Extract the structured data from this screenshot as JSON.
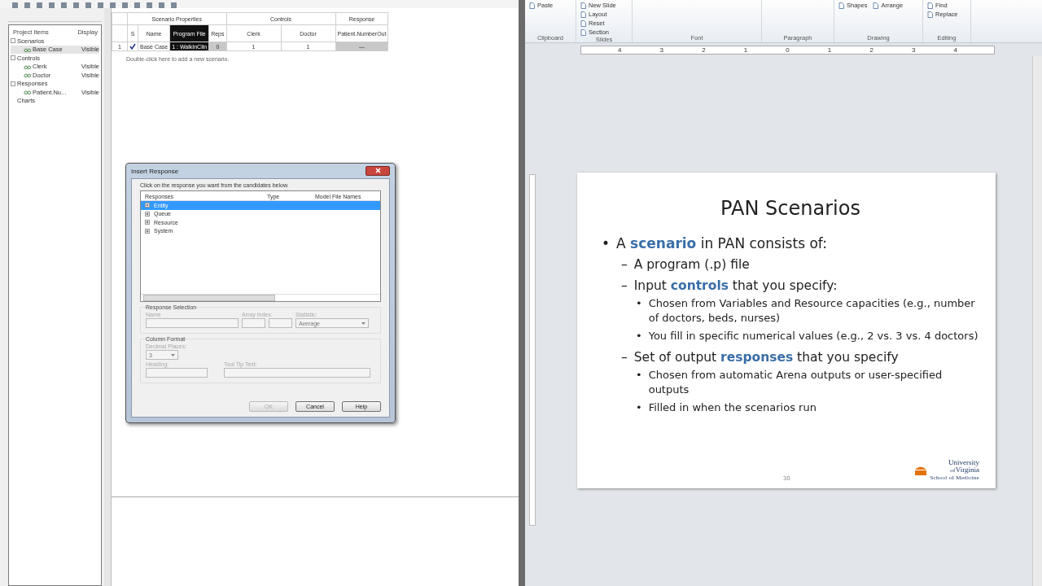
{
  "scenario_app": {
    "project_tree": {
      "columns": [
        "Project Items",
        "Display"
      ],
      "items": [
        {
          "label": "Scenarios",
          "expanded": true,
          "children": [
            {
              "label": "Base Case",
              "display": "Visible",
              "selected": true
            }
          ]
        },
        {
          "label": "Controls",
          "expanded": true,
          "children": [
            {
              "label": "Clerk",
              "display": "Visible",
              "selected": false
            },
            {
              "label": "Doctor",
              "display": "Visible",
              "selected": false
            }
          ]
        },
        {
          "label": "Responses",
          "expanded": true,
          "children": [
            {
              "label": "Patient.Nu...",
              "display": "Visible",
              "selected": false
            }
          ]
        },
        {
          "label": "Charts"
        }
      ]
    },
    "scenario_table": {
      "groups": [
        {
          "label": "Scenario Properties"
        },
        {
          "label": "Controls"
        },
        {
          "label": "Response"
        }
      ],
      "check_column": "S",
      "columns": [
        {
          "label": "Name",
          "selected": false
        },
        {
          "label": "Program File",
          "selected": true
        },
        {
          "label": "Reps",
          "selected": false
        },
        {
          "label": "Clerk",
          "selected": false
        },
        {
          "label": "Doctor",
          "selected": false
        },
        {
          "label": "Patient.NumberOut",
          "selected": false
        }
      ],
      "rows": [
        {
          "number": "1",
          "checked": true,
          "cells": [
            "Base Case",
            "1 : WalkInClin",
            "0",
            "1",
            "1",
            "—"
          ]
        }
      ],
      "hint": "Double-click here to add a new scenario."
    }
  },
  "dialog": {
    "title": "Insert Response",
    "instruction": "Click on the response you want from the candidates below.",
    "list_columns": [
      "Responses",
      "Type",
      "Model File Names"
    ],
    "items": [
      {
        "label": "Entity",
        "selected": true
      },
      {
        "label": "Queue",
        "selected": false
      },
      {
        "label": "Resource",
        "selected": false
      },
      {
        "label": "System",
        "selected": false
      }
    ],
    "response_selection": {
      "title": "Response Selection",
      "name_label": "Name",
      "array_index_label": "Array Index:",
      "statistic_label": "Statistic:",
      "statistic_value": "Average"
    },
    "column_format": {
      "title": "Column Format",
      "decimal_places_label": "Decimal Places:",
      "decimal_places_value": "3",
      "heading_label": "Heading:",
      "tooltip_label": "Tool Tip Text:"
    },
    "buttons": [
      {
        "label": "OK",
        "disabled": true
      },
      {
        "label": "Cancel",
        "disabled": false
      },
      {
        "label": "Help",
        "disabled": false
      }
    ]
  },
  "ribbon": {
    "groups": [
      {
        "label": "Clipboard",
        "commands": [
          "Paste"
        ]
      },
      {
        "label": "Slides",
        "commands": [
          "New Slide",
          "Layout",
          "Reset",
          "Section"
        ]
      },
      {
        "label": "Font"
      },
      {
        "label": "Paragraph"
      },
      {
        "label": "Drawing",
        "commands": [
          "Shapes",
          "Arrange"
        ]
      },
      {
        "label": "Editing",
        "commands": [
          "Find",
          "Replace"
        ]
      }
    ],
    "ruler": [
      "4",
      "3",
      "2",
      "1",
      "0",
      "1",
      "2",
      "3",
      "4"
    ]
  },
  "slide": {
    "title": "PAN Scenarios",
    "bullets": [
      {
        "marker": "•",
        "text": "A **scenario** in PAN consists of:",
        "children": [
          {
            "marker": "–",
            "text": "A program (.p) file"
          },
          {
            "marker": "–",
            "text": "Input **controls** that you specify:",
            "children": [
              {
                "marker": "•",
                "text": "Chosen from Variables and Resource capacities (e.g., number of doctors, beds, nurses)"
              },
              {
                "marker": "•",
                "text": "You fill in specific numerical values (e.g., 2 vs. 3 vs. 4 doctors)"
              }
            ]
          },
          {
            "marker": "–",
            "text": "Set of output **responses** that you specify",
            "children": [
              {
                "marker": "•",
                "text": "Chosen from automatic Arena outputs or user-specified outputs"
              },
              {
                "marker": "•",
                "text": "Filled in when the scenarios run"
              }
            ]
          }
        ]
      }
    ],
    "page_number": "30",
    "logo": {
      "line1": "University",
      "line2": "of",
      "line3": "Virginia",
      "line4": "School of Medicine"
    }
  }
}
